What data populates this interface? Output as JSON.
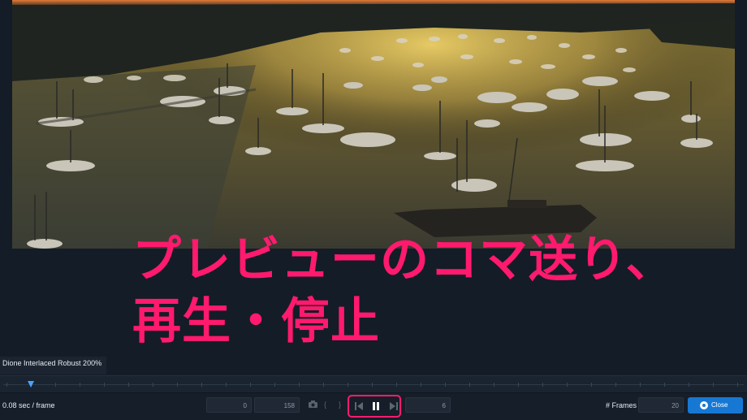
{
  "caption": {
    "line1": "プレビューのコマ送り、",
    "line2": "再生・停止"
  },
  "preset_label": "Dione Interlaced Robust 200%",
  "toolbar": {
    "duration_label": "0.08 sec / frame",
    "start_frame": "0",
    "end_frame": "158",
    "current_frame": "6",
    "frames_label": "# Frames",
    "frames_value": "20",
    "close_label": "Close",
    "icons": {
      "camera": "camera-icon",
      "mark_in": "bracket-left-icon",
      "mark_out": "bracket-right-icon",
      "step_back": "step-back-icon",
      "pause": "pause-icon",
      "step_forward": "step-forward-icon"
    }
  },
  "colors": {
    "caption": "#ff1a6e",
    "accent": "#1778d4",
    "background": "#141c27"
  }
}
